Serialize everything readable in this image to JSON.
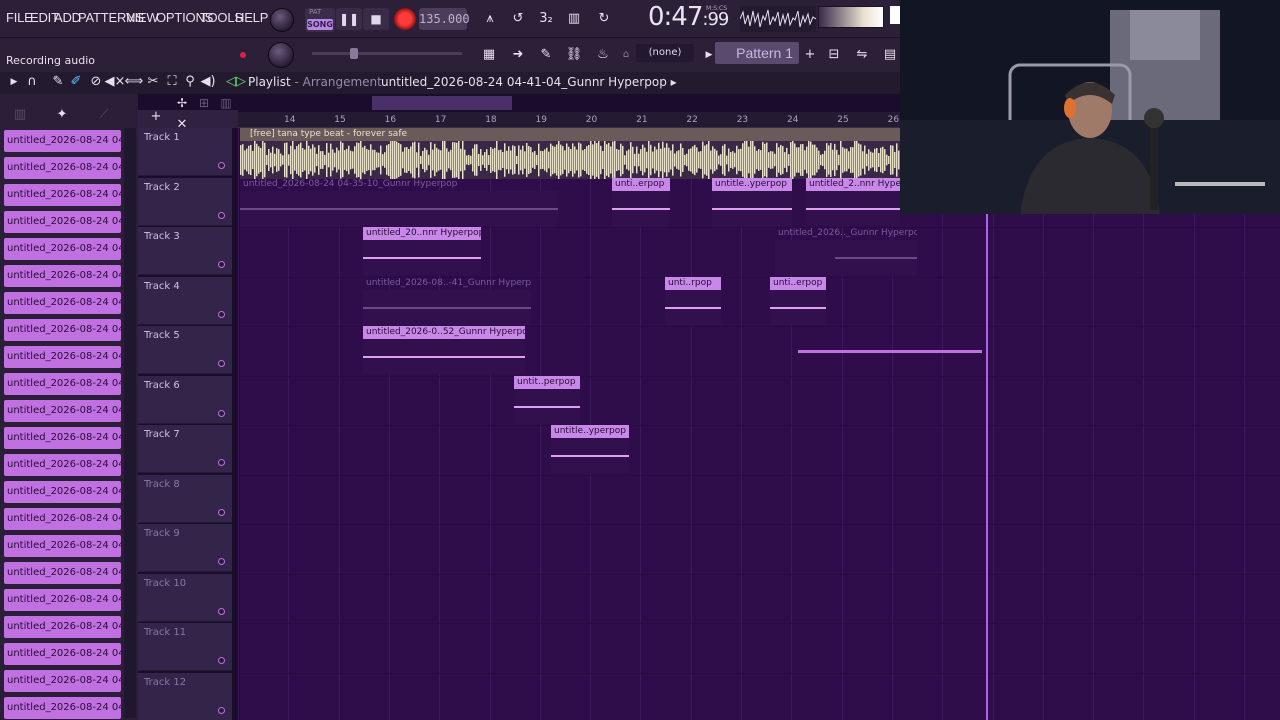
{
  "menu": [
    "FILE",
    "EDIT",
    "ADD",
    "PATTERNS",
    "VIEW",
    "OPTIONS",
    "TOOLS",
    "HELP"
  ],
  "transport": {
    "pat": "PAT",
    "song": "SONG",
    "tempo": "135.000",
    "time_main": "0:47",
    "time_cs": "99",
    "time_units": "M:S:CS"
  },
  "hint_bar": "Recording audio",
  "channel_select": "(none)",
  "pattern_name": "Pattern 1",
  "playlist": {
    "title": "Playlist",
    "subtitle": "Arrangement",
    "separator": " - ",
    "current_track": "untitled_2026-08-24 04-41-04_Gunnr Hyperpop",
    "arrow": "▸"
  },
  "picker_items": [
    "untitled_2026-08-24 04-...",
    "untitled_2026-08-24 04-...",
    "untitled_2026-08-24 04-...",
    "untitled_2026-08-24 04-...",
    "untitled_2026-08-24 04-...",
    "untitled_2026-08-24 04-...",
    "untitled_2026-08-24 04-...",
    "untitled_2026-08-24 04-...",
    "untitled_2026-08-24 04-...",
    "untitled_2026-08-24 04-...",
    "untitled_2026-08-24 04-...",
    "untitled_2026-08-24 04-...",
    "untitled_2026-08-24 04-...",
    "untitled_2026-08-24 04-...",
    "untitled_2026-08-24 04-...",
    "untitled_2026-08-24 04-...",
    "untitled_2026-08-24 04-...",
    "untitled_2026-08-24 04-...",
    "untitled_2026-08-24 04-...",
    "untitled_2026-08-24 04-...",
    "untitled_2026-08-24 04-...",
    "untitled_2026-08-24 04-..."
  ],
  "ruler": [
    "14",
    "15",
    "16",
    "17",
    "18",
    "19",
    "20",
    "21",
    "22",
    "23",
    "24",
    "25",
    "26"
  ],
  "tracks": [
    "Track 1",
    "Track 2",
    "Track 3",
    "Track 4",
    "Track 5",
    "Track 6",
    "Track 7",
    "Track 8",
    "Track 9",
    "Track 10",
    "Track 11",
    "Track 12"
  ],
  "clips": {
    "t1": "[free] tana type beat - forever safe",
    "t2a": "untitled_2026-08-24 04-35-10_Gunnr Hyperpop",
    "t2b": "unti..erpop",
    "t2c": "untitle..yperpop",
    "t2d": "untitled_2..nnr Hype",
    "t3a": "untitled_20..nnr Hyperpop",
    "t3b": "untitled_2026.._Gunnr Hyperpop",
    "t4a": "untitled_2026-08..-41_Gunnr Hyperpop",
    "t4b": "unti..rpop",
    "t4c": "unti..erpop",
    "t5a": "untitled_2026-0..52_Gunnr Hyperpop",
    "t6a": "untit..perpop",
    "t7a": "untitle..yperpop"
  },
  "colors": {
    "accent": "#c070e0",
    "background": "#2e0d4a",
    "cursor": "#b060f0"
  }
}
